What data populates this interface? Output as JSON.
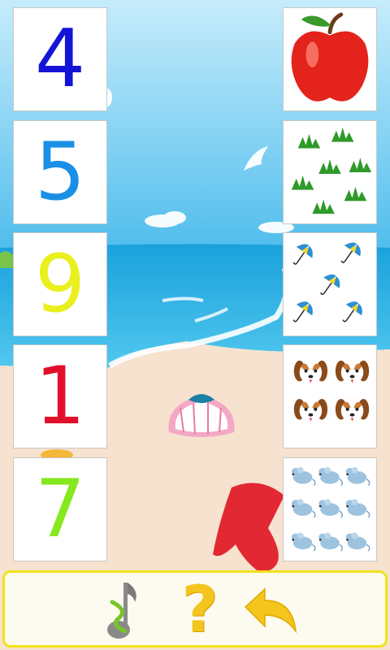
{
  "numbers": [
    {
      "value": "4",
      "color": "#1414d6"
    },
    {
      "value": "5",
      "color": "#1a8fe6"
    },
    {
      "value": "9",
      "color": "#e9f01e"
    },
    {
      "value": "1",
      "color": "#e0102a"
    },
    {
      "value": "7",
      "color": "#86e81e"
    }
  ],
  "pictures": [
    {
      "icon": "apple-icon",
      "count": 1
    },
    {
      "icon": "grass-icon",
      "count": 5
    },
    {
      "icon": "umbrella-icon",
      "count": 9
    },
    {
      "icon": "puppy-icon",
      "count": 4
    },
    {
      "icon": "mouse-icon",
      "count": 7
    }
  ],
  "toolbar": {
    "music_icon": "music-note-icon",
    "help_label": "?",
    "back_icon": "back-arrow-icon",
    "help_color": "#f4c51d",
    "back_color": "#f4c51d",
    "border_color": "#f2e21a"
  },
  "colors": {
    "sky": "#5fc3ef",
    "sea": "#27a7dd",
    "sand": "#f7e2cf"
  }
}
